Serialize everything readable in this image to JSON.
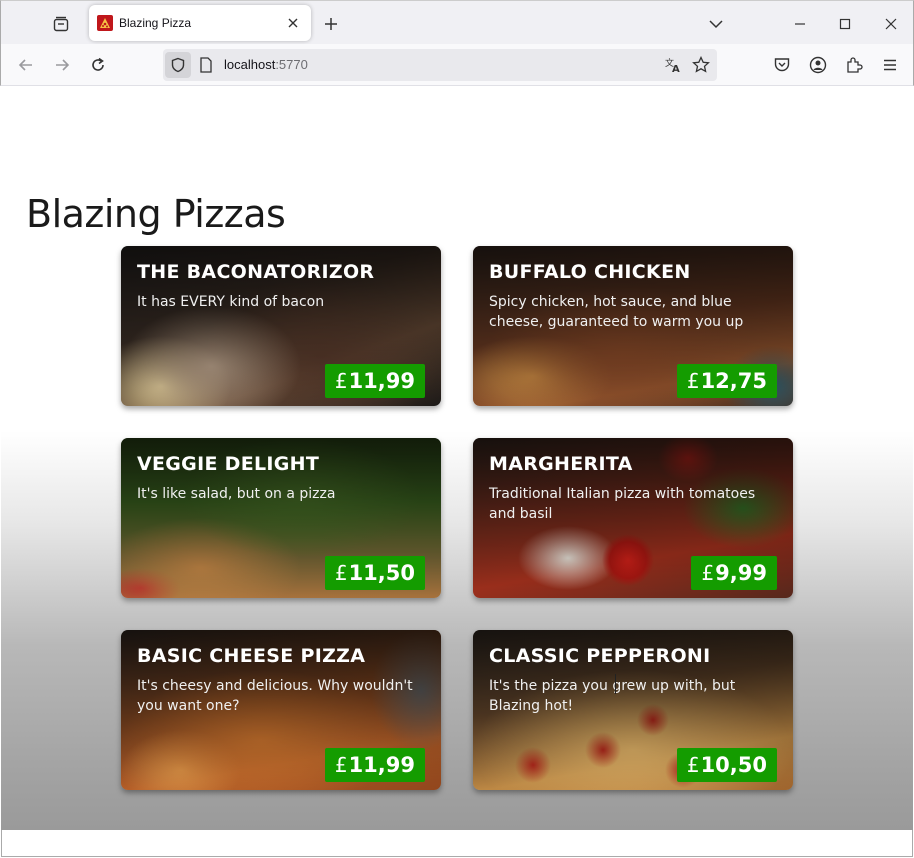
{
  "browser": {
    "tab_title": "Blazing Pizza",
    "url_host": "localhost",
    "url_port": ":5770"
  },
  "page": {
    "title": "Blazing Pizzas"
  },
  "specials": [
    {
      "name": "THE BACONATORIZOR",
      "description": "It has EVERY kind of bacon",
      "currency": "£",
      "price": "11,99"
    },
    {
      "name": "BUFFALO CHICKEN",
      "description": "Spicy chicken, hot sauce, and blue cheese, guaranteed to warm you up",
      "currency": "£",
      "price": "12,75"
    },
    {
      "name": "VEGGIE DELIGHT",
      "description": "It's like salad, but on a pizza",
      "currency": "£",
      "price": "11,50"
    },
    {
      "name": "MARGHERITA",
      "description": "Traditional Italian pizza with tomatoes and basil",
      "currency": "£",
      "price": "9,99"
    },
    {
      "name": "BASIC CHEESE PIZZA",
      "description": "It's cheesy and delicious. Why wouldn't you want one?",
      "currency": "£",
      "price": "11,99"
    },
    {
      "name": "CLASSIC PEPPERONI",
      "description": "It's the pizza you grew up with, but Blazing hot!",
      "currency": "£",
      "price": "10,50"
    }
  ],
  "colors": {
    "price_badge": "#149c00",
    "favicon": "#c0171b"
  },
  "icons": [
    "tab-list-icon",
    "pizza-favicon-icon",
    "close-icon",
    "plus-icon",
    "chevron-down-icon",
    "minimize-icon",
    "maximize-icon",
    "back-icon",
    "forward-icon",
    "reload-icon",
    "shield-icon",
    "page-icon",
    "translate-icon",
    "star-icon",
    "pocket-icon",
    "account-icon",
    "extensions-icon",
    "menu-icon"
  ]
}
